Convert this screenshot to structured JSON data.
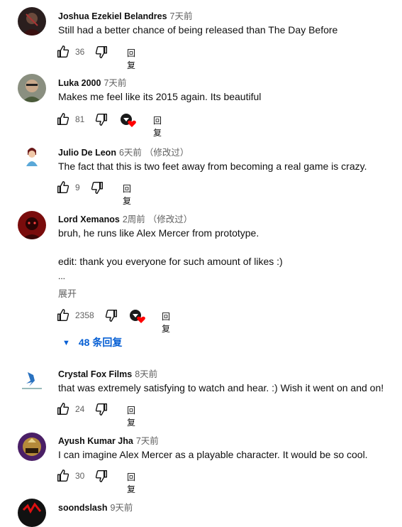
{
  "comments": [
    {
      "author": "Joshua Ezekiel Belandres",
      "time": "7天前",
      "edited": "",
      "text": "Still had a better chance of being released than The Day Before",
      "likes": "36",
      "reply_label": "回复",
      "has_heart": false
    },
    {
      "author": "Luka 2000",
      "time": "7天前",
      "edited": "",
      "text": "Makes me feel like its 2015 again. Its beautiful",
      "likes": "81",
      "reply_label": "回复",
      "has_heart": true
    },
    {
      "author": "Julio De Leon",
      "time": "6天前",
      "edited": "（修改过）",
      "text": "The fact that this is two feet away from becoming a real game is crazy.",
      "likes": "9",
      "reply_label": "回复",
      "has_heart": false
    },
    {
      "author": "Lord Xemanos",
      "time": "2周前",
      "edited": "（修改过）",
      "text": "bruh, he runs like Alex Mercer from prototype.",
      "text2": "edit: thank you everyone for such amount of likes :)",
      "ellipsis": "...",
      "expand": "展开",
      "likes": "2358",
      "reply_label": "回复",
      "has_heart": true,
      "replies_toggle": "48 条回复"
    },
    {
      "author": "Crystal Fox Films",
      "time": "8天前",
      "edited": "",
      "text": "that was extremely satisfying to watch and hear. :) Wish it went on and on!",
      "likes": "24",
      "reply_label": "回复",
      "has_heart": false
    },
    {
      "author": "Ayush Kumar Jha",
      "time": "7天前",
      "edited": "",
      "text": "I can imagine Alex Mercer as a playable character. It would be so cool.",
      "likes": "30",
      "reply_label": "回复",
      "has_heart": false
    },
    {
      "author": "soondslash",
      "time": "9天前",
      "edited": ""
    }
  ],
  "icons": {
    "like": "thumbs-up-icon",
    "dislike": "thumbs-down-icon",
    "creator_heart": "creator-heart-icon",
    "expand": "chevron-down-icon"
  },
  "colors": {
    "link": "#065fd4",
    "heart": "#ff0000",
    "secondary_text": "#606060"
  }
}
